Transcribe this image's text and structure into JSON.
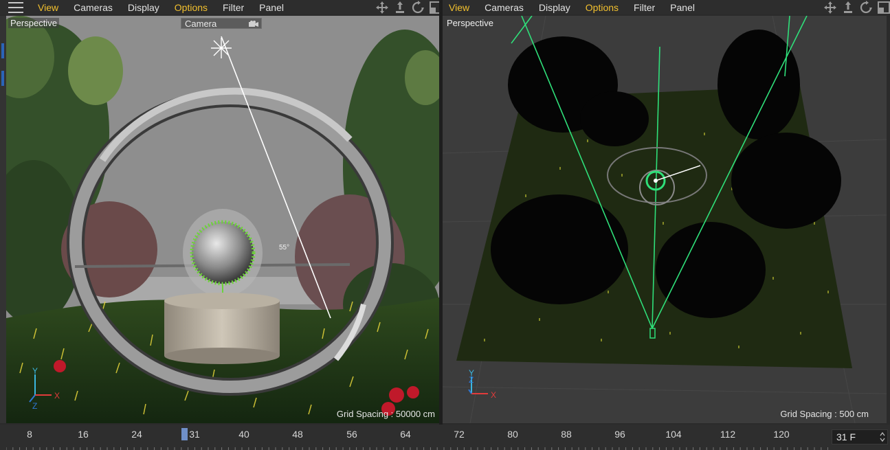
{
  "left_panel": {
    "menu": [
      "View",
      "Cameras",
      "Display",
      "Options",
      "Filter",
      "Panel"
    ],
    "accent_items": [
      "View",
      "Options"
    ],
    "viewport_label": "Perspective",
    "camera_chip": "Camera",
    "grid_spacing": "Grid Spacing : 50000 cm",
    "angle_label": "55°",
    "axes": {
      "y": "Y",
      "x": "X",
      "z": "Z"
    }
  },
  "right_panel": {
    "menu": [
      "View",
      "Cameras",
      "Display",
      "Options",
      "Filter",
      "Panel"
    ],
    "viewport_label": "Perspective",
    "grid_spacing": "Grid Spacing : 500 cm",
    "axes": {
      "y": "Y",
      "x": "X",
      "z": "Z"
    }
  },
  "timeline": {
    "ticks": [
      "8",
      "16",
      "24",
      "31",
      "40",
      "48",
      "56",
      "64",
      "72",
      "80",
      "88",
      "96",
      "104",
      "112",
      "120"
    ],
    "current_frame": "31",
    "frame_field": "31 F"
  },
  "colors": {
    "accent": "#f2c02e",
    "panel_bg": "#2d2d2d",
    "timeline_marker": "#6f8fc8",
    "axis_x": "#e23b3b",
    "axis_y": "#3bb8e2",
    "light_green": "#2fe07a"
  },
  "icons": [
    "menu-icon",
    "move-icon",
    "scale-icon",
    "rotate-icon",
    "maximize-icon",
    "camera-icon"
  ]
}
